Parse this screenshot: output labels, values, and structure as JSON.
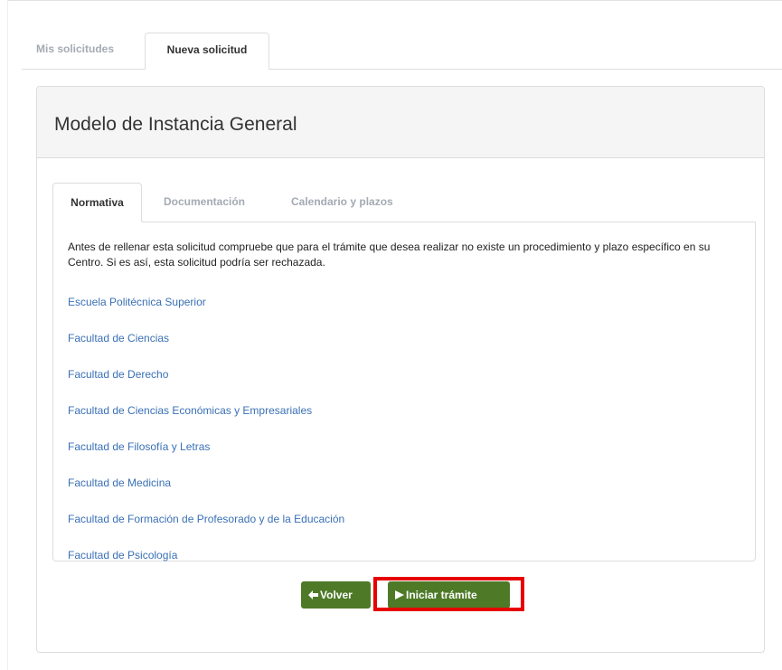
{
  "outer_tabs": [
    {
      "label": "Mis solicitudes",
      "active": false
    },
    {
      "label": "Nueva solicitud",
      "active": true
    }
  ],
  "panel": {
    "title": "Modelo de Instancia General"
  },
  "inner_tabs": [
    {
      "label": "Normativa",
      "active": true
    },
    {
      "label": "Documentación",
      "active": false
    },
    {
      "label": "Calendario y plazos",
      "active": false
    }
  ],
  "normativa": {
    "intro": "Antes de rellenar esta solicitud compruebe que para el trámite que desea realizar no existe un procedimiento y plazo específico en su Centro. Si es así, esta solicitud podría ser rechazada.",
    "links": [
      "Escuela Politécnica Superior",
      "Facultad de Ciencias",
      "Facultad de Derecho",
      "Facultad de Ciencias Económicas y Empresariales",
      "Facultad de Filosofía y Letras",
      "Facultad de Medicina",
      "Facultad de Formación de Profesorado y de la Educación",
      "Facultad de Psicología"
    ]
  },
  "buttons": {
    "back_label": "Volver",
    "back_icon": "arrow-left-icon",
    "start_label": "Iniciar trámite",
    "start_icon": "play-icon"
  },
  "colors": {
    "button_green": "#4e7a28",
    "link_blue": "#3a70b5",
    "highlight_red": "#e60000"
  }
}
